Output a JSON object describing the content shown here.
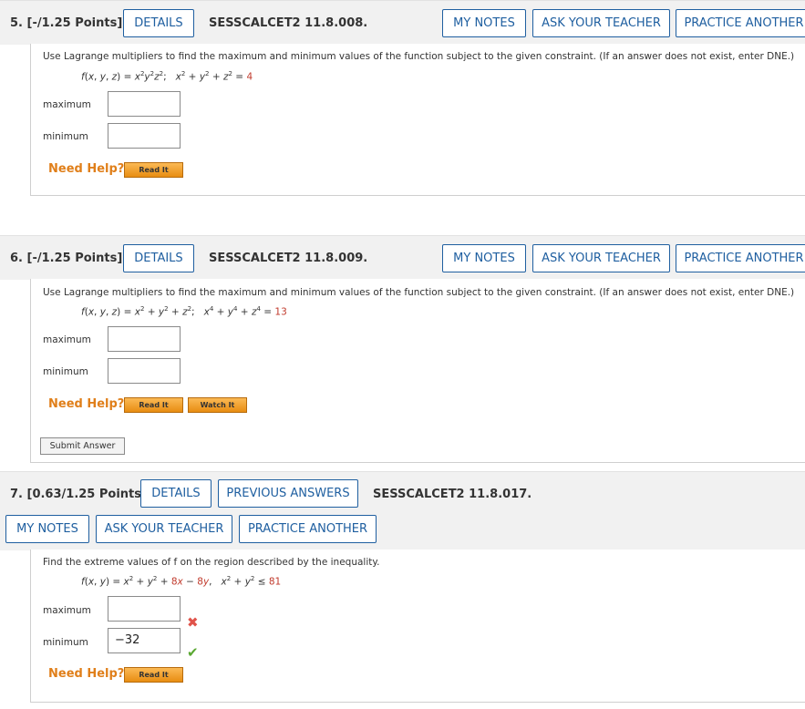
{
  "q5": {
    "title": "5. [-/1.25 Points]",
    "details": "DETAILS",
    "code": "SESSCALCET2 11.8.008.",
    "my_notes": "MY NOTES",
    "ask_teacher": "ASK YOUR TEACHER",
    "practice": "PRACTICE ANOTHER",
    "prompt": "Use Lagrange multipliers to find the maximum and minimum values of the function subject to the given constraint. (If an answer does not exist, enter DNE.)",
    "f_lhs": "f(x, y, z) = x",
    "constraint_rhs": "4",
    "maximum_label": "maximum",
    "minimum_label": "minimum",
    "maximum_value": "",
    "minimum_value": "",
    "need_help": "Need Help?",
    "read_it": "Read It"
  },
  "q6": {
    "title": "6. [-/1.25 Points]",
    "details": "DETAILS",
    "code": "SESSCALCET2 11.8.009.",
    "my_notes": "MY NOTES",
    "ask_teacher": "ASK YOUR TEACHER",
    "practice": "PRACTICE ANOTHER",
    "prompt": "Use Lagrange multipliers to find the maximum and minimum values of the function subject to the given constraint. (If an answer does not exist, enter DNE.)",
    "constraint_rhs": "13",
    "maximum_label": "maximum",
    "minimum_label": "minimum",
    "maximum_value": "",
    "minimum_value": "",
    "need_help": "Need Help?",
    "read_it": "Read It",
    "watch_it": "Watch It",
    "submit": "Submit Answer"
  },
  "q7": {
    "title": "7. [0.63/1.25 Points]",
    "details": "DETAILS",
    "previous": "PREVIOUS ANSWERS",
    "code": "SESSCALCET2 11.8.017.",
    "my_notes": "MY NOTES",
    "ask_teacher": "ASK YOUR TEACHER",
    "practice": "PRACTICE ANOTHER",
    "prompt": "Find the extreme values of f on the region described by the inequality.",
    "constraint_rhs": "81",
    "maximum_label": "maximum",
    "minimum_label": "minimum",
    "maximum_value": "",
    "minimum_value": "−32",
    "maximum_status": "✖",
    "minimum_status": "✔",
    "need_help": "Need Help?",
    "read_it": "Read It"
  },
  "colors": {
    "link_blue": "#1f5fa0",
    "help_orange": "#e07f1a",
    "red": "#c0392b",
    "correct_green": "#5aa832",
    "incorrect_red": "#e0534a"
  }
}
